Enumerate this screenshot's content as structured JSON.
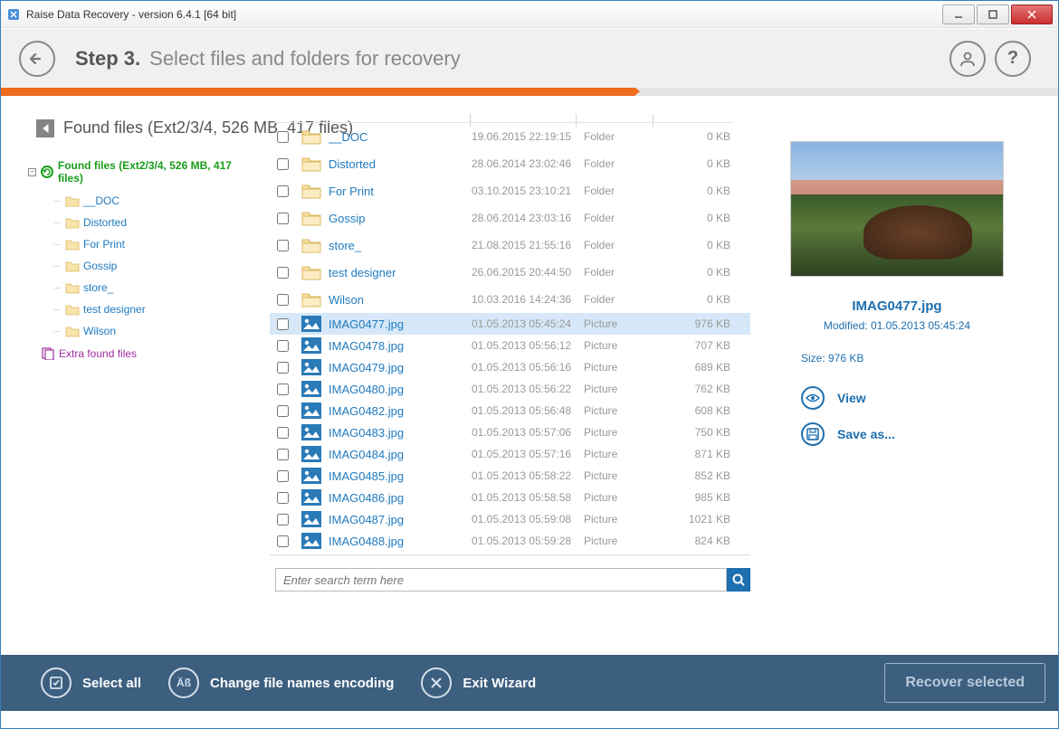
{
  "window": {
    "title": "Raise Data Recovery - version 6.4.1 [64 bit]"
  },
  "header": {
    "step_label": "Step 3.",
    "step_desc": "Select files and folders for recovery"
  },
  "found_heading": "Found files (Ext2/3/4, 526 MB, 417 files)",
  "tree": {
    "root": "Found files (Ext2/3/4, 526 MB, 417 files)",
    "children": [
      "__DOC",
      "Distorted",
      "For Print",
      "Gossip",
      "store_",
      "test designer",
      "Wilson"
    ],
    "extra": "Extra found files"
  },
  "files": [
    {
      "name": "__DOC",
      "date": "19.06.2015 22:19:15",
      "type": "Folder",
      "size": "0 KB",
      "icon": "folder"
    },
    {
      "name": "Distorted",
      "date": "28.06.2014 23:02:46",
      "type": "Folder",
      "size": "0 KB",
      "icon": "folder"
    },
    {
      "name": "For Print",
      "date": "03.10.2015 23:10:21",
      "type": "Folder",
      "size": "0 KB",
      "icon": "folder"
    },
    {
      "name": "Gossip",
      "date": "28.06.2014 23:03:16",
      "type": "Folder",
      "size": "0 KB",
      "icon": "folder"
    },
    {
      "name": "store_",
      "date": "21.08.2015 21:55:16",
      "type": "Folder",
      "size": "0 KB",
      "icon": "folder"
    },
    {
      "name": "test designer",
      "date": "26.06.2015 20:44:50",
      "type": "Folder",
      "size": "0 KB",
      "icon": "folder"
    },
    {
      "name": "Wilson",
      "date": "10.03.2016 14:24:36",
      "type": "Folder",
      "size": "0 KB",
      "icon": "folder"
    },
    {
      "name": "IMAG0477.jpg",
      "date": "01.05.2013 05:45:24",
      "type": "Picture",
      "size": "976 KB",
      "icon": "image",
      "selected": true
    },
    {
      "name": "IMAG0478.jpg",
      "date": "01.05.2013 05:56:12",
      "type": "Picture",
      "size": "707 KB",
      "icon": "image"
    },
    {
      "name": "IMAG0479.jpg",
      "date": "01.05.2013 05:56:16",
      "type": "Picture",
      "size": "689 KB",
      "icon": "image"
    },
    {
      "name": "IMAG0480.jpg",
      "date": "01.05.2013 05:56:22",
      "type": "Picture",
      "size": "762 KB",
      "icon": "image"
    },
    {
      "name": "IMAG0482.jpg",
      "date": "01.05.2013 05:56:48",
      "type": "Picture",
      "size": "608 KB",
      "icon": "image"
    },
    {
      "name": "IMAG0483.jpg",
      "date": "01.05.2013 05:57:06",
      "type": "Picture",
      "size": "750 KB",
      "icon": "image"
    },
    {
      "name": "IMAG0484.jpg",
      "date": "01.05.2013 05:57:16",
      "type": "Picture",
      "size": "871 KB",
      "icon": "image"
    },
    {
      "name": "IMAG0485.jpg",
      "date": "01.05.2013 05:58:22",
      "type": "Picture",
      "size": "852 KB",
      "icon": "image"
    },
    {
      "name": "IMAG0486.jpg",
      "date": "01.05.2013 05:58:58",
      "type": "Picture",
      "size": "985 KB",
      "icon": "image"
    },
    {
      "name": "IMAG0487.jpg",
      "date": "01.05.2013 05:59:08",
      "type": "Picture",
      "size": "1021 KB",
      "icon": "image"
    },
    {
      "name": "IMAG0488.jpg",
      "date": "01.05.2013 05:59:28",
      "type": "Picture",
      "size": "824 KB",
      "icon": "image"
    }
  ],
  "search": {
    "placeholder": "Enter search term here"
  },
  "preview": {
    "name": "IMAG0477.jpg",
    "modified": "Modified: 01.05.2013 05:45:24",
    "size": "Size: 976 KB",
    "view": "View",
    "save": "Save as..."
  },
  "footer": {
    "select_all": "Select all",
    "encoding": "Change file names encoding",
    "exit": "Exit Wizard",
    "recover": "Recover selected"
  }
}
